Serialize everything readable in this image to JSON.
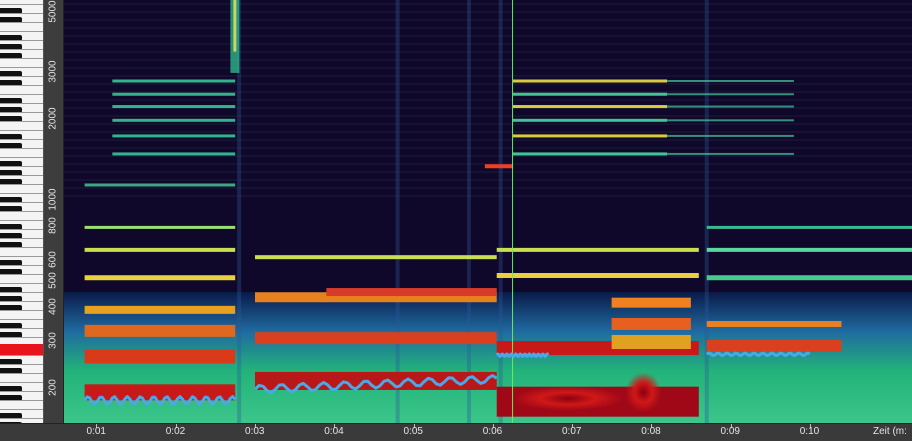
{
  "frequency_axis": {
    "labels": [
      {
        "text": "5000",
        "value": 5000
      },
      {
        "text": "3000",
        "value": 3000
      },
      {
        "text": "2000",
        "value": 2000
      },
      {
        "text": "1000",
        "value": 1000
      },
      {
        "text": "800",
        "value": 800
      },
      {
        "text": "600",
        "value": 600
      },
      {
        "text": "500",
        "value": 500
      },
      {
        "text": "400",
        "value": 400
      },
      {
        "text": "300",
        "value": 300
      },
      {
        "text": "200",
        "value": 200
      }
    ],
    "min_hz": 150,
    "max_hz": 5600,
    "scale": "log"
  },
  "time_axis": {
    "labels": [
      "0:01",
      "0:02",
      "0:03",
      "0:04",
      "0:05",
      "0:06",
      "0:07",
      "0:08",
      "0:09",
      "0:10"
    ],
    "axis_title": "Zeit (m:",
    "start_s": 0.59,
    "end_s": 11.29
  },
  "playhead": {
    "time_s": 6.25,
    "color": "#66ee55"
  },
  "pitch_track_color": "#4ba8e8",
  "piano_marker_color": "#e8141c"
}
